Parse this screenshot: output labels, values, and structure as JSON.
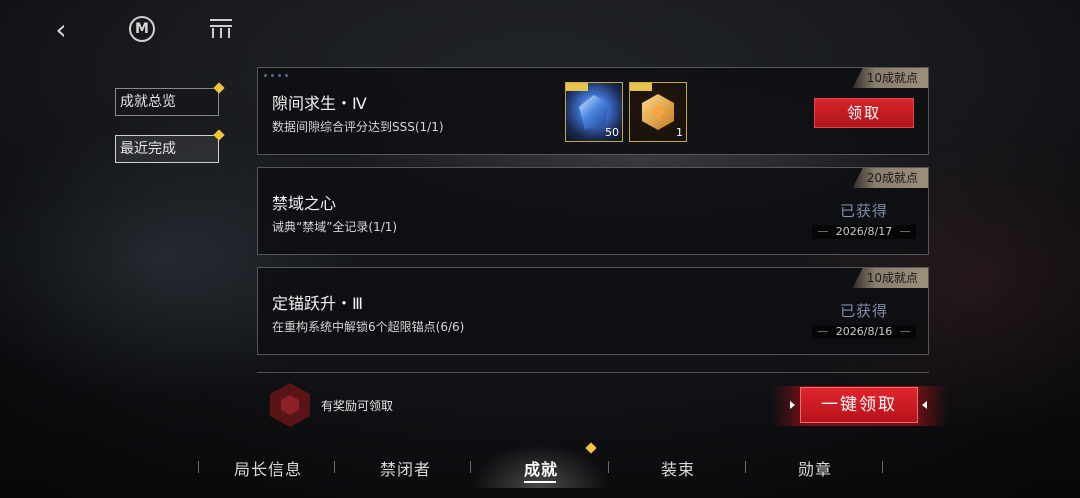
{
  "topbar": {
    "back_icon": "chevron-left-icon",
    "profile_icon": "m-emblem-icon",
    "menu_icon": "grid-menu-icon"
  },
  "side_tabs": [
    {
      "label": "成就总览",
      "active": false,
      "has_dot": true
    },
    {
      "label": "最近完成",
      "active": true,
      "has_dot": true
    }
  ],
  "achievements": [
    {
      "title": "隙间求生・Ⅳ",
      "desc": "数据间隙综合评分达到SSS(1/1)",
      "points": "10成就点",
      "status": "claim",
      "claim_label": "领取",
      "rewards": [
        {
          "icon": "blue-crystal-icon",
          "count": "50"
        },
        {
          "icon": "gold-hexagon-icon",
          "count": "1"
        }
      ]
    },
    {
      "title": "禁域之心",
      "desc": "诫典“禁域”全记录(1/1)",
      "points": "20成就点",
      "status": "obtained",
      "obtained_label": "已获得",
      "date": "2026/8/17"
    },
    {
      "title": "定锚跃升・Ⅲ",
      "desc": "在重构系统中解锁6个超限锚点(6/6)",
      "points": "10成就点",
      "status": "obtained",
      "obtained_label": "已获得",
      "date": "2026/8/16"
    }
  ],
  "footer": {
    "hint": "有奖励可领取",
    "claim_all_label": "一键领取"
  },
  "nav": {
    "items": [
      "局长信息",
      "禁闭者",
      "成就",
      "装束",
      "勋章"
    ],
    "active_index": 2
  },
  "colors": {
    "accent_red": "#d5262b",
    "badge_gold": "#f3c33a",
    "obtained_blue": "#7d8ba6"
  }
}
